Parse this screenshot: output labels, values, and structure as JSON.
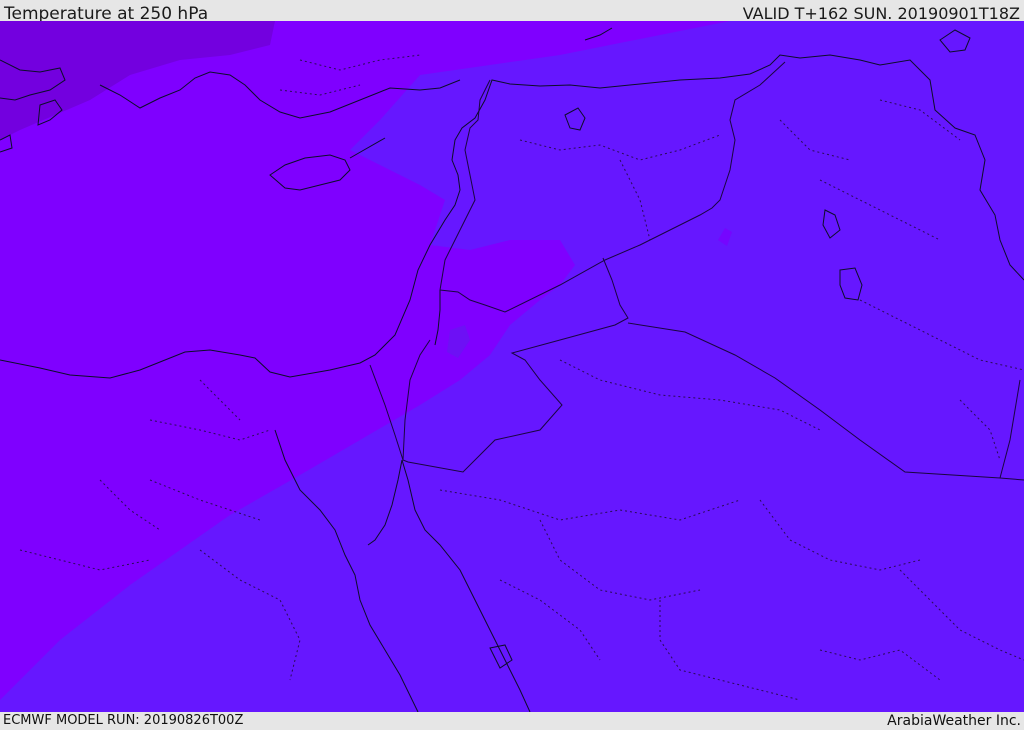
{
  "header": {
    "title": "Temperature at 250 hPa",
    "valid": "VALID T+162 SUN. 20190901T18Z"
  },
  "footer": {
    "model_run": "ECMWF MODEL RUN: 20190826T00Z",
    "credit": "ArabiaWeather Inc."
  },
  "colors": {
    "warm_band": "#6617ff",
    "mid_band": "#7f00ff",
    "cold_band": "#7300df",
    "coast": "#0d0d2a",
    "borders": "#2a0a55",
    "chrome": "#e6e6e6"
  }
}
